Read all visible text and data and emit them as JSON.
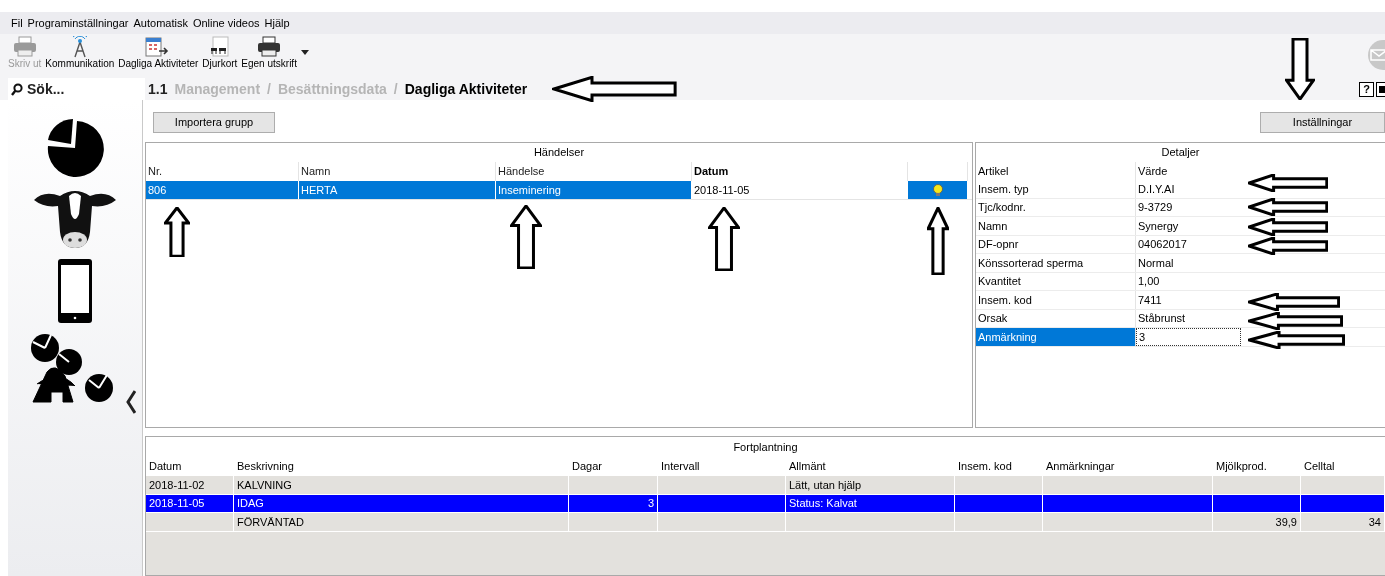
{
  "menu": [
    "Fil",
    "Programinställningar",
    "Automatisk",
    "Online videos",
    "Hjälp"
  ],
  "toolbar": [
    {
      "kind": "printer",
      "label": "Skriv ut",
      "disabled": true
    },
    {
      "kind": "antenna",
      "label": "Kommunikation",
      "disabled": false
    },
    {
      "kind": "calendar",
      "label": "Dagliga Aktiviteter",
      "disabled": false
    },
    {
      "kind": "card",
      "label": "Djurkort",
      "disabled": false
    },
    {
      "kind": "printer",
      "label": "Egen utskrift",
      "disabled": false
    }
  ],
  "help_button": "?",
  "search": {
    "placeholder": "Sök..."
  },
  "breadcrumb": {
    "number": "1.1",
    "separator": "/",
    "items": [
      {
        "label": "Management",
        "current": false
      },
      {
        "label": "Besättningsdata",
        "current": false
      },
      {
        "label": "Dagliga Aktiviteter",
        "current": true
      }
    ]
  },
  "sidebar": [
    {
      "kind": "pie"
    },
    {
      "kind": "cow"
    },
    {
      "kind": "phone"
    },
    {
      "kind": "farm"
    }
  ],
  "buttons": {
    "import": "Importera grupp",
    "settings": "Inställningar"
  },
  "events": {
    "title": "Händelser",
    "columns": [
      {
        "label": "Nr.",
        "sorted": false
      },
      {
        "label": "Namn",
        "sorted": false
      },
      {
        "label": "Händelse",
        "sorted": false
      },
      {
        "label": "Datum",
        "sorted": true
      }
    ],
    "rows": [
      {
        "cells": [
          {
            "kind": "text",
            "text": "806",
            "selected": true
          },
          {
            "kind": "text",
            "text": "HERTA",
            "selected": true
          },
          {
            "kind": "text",
            "text": "Inseminering",
            "selected": true
          },
          {
            "kind": "text",
            "text": "2018-11-05",
            "selected": false
          },
          {
            "kind": "bulb",
            "selected": true
          }
        ]
      }
    ]
  },
  "details": {
    "title": "Detaljer",
    "columns": [
      "Artikel",
      "Värde"
    ],
    "rows": [
      {
        "label": "Insem. typ",
        "value": "D.I.Y.AI",
        "selected": false
      },
      {
        "label": "Tjc/kodnr.",
        "value": "9-3729",
        "selected": false
      },
      {
        "label": "Namn",
        "value": "Synergy",
        "selected": false
      },
      {
        "label": "DF-opnr",
        "value": "04062017",
        "selected": false
      },
      {
        "label": "Könssorterad sperma",
        "value": "Normal",
        "selected": false
      },
      {
        "label": "Kvantitet",
        "value": "1,00",
        "selected": false
      },
      {
        "label": "Insem. kod",
        "value": "7411",
        "selected": false
      },
      {
        "label": "Orsak",
        "value": "Ståbrunst",
        "selected": false
      },
      {
        "label": "Anmärkning",
        "value": "3",
        "selected": true
      }
    ]
  },
  "reproduction": {
    "title": "Fortplantning",
    "columns": [
      "Datum",
      "Beskrivning",
      "Dagar",
      "Intervall",
      "Allmänt",
      "Insem. kod",
      "Anmärkningar",
      "Mjölkprod.",
      "Celltal"
    ],
    "rows": [
      {
        "cells": [
          "2018-11-02",
          "KALVNING",
          "",
          "",
          "Lätt, utan hjälp",
          "",
          "",
          "",
          ""
        ],
        "selected": false
      },
      {
        "cells": [
          "2018-11-05",
          "IDAG",
          "3",
          "",
          "Status: Kalvat",
          "",
          "",
          "",
          ""
        ],
        "selected": true
      },
      {
        "cells": [
          "",
          "FÖRVÄNTAD",
          "",
          "",
          "",
          "",
          "",
          "39,9",
          "34"
        ],
        "selected": false
      }
    ]
  }
}
